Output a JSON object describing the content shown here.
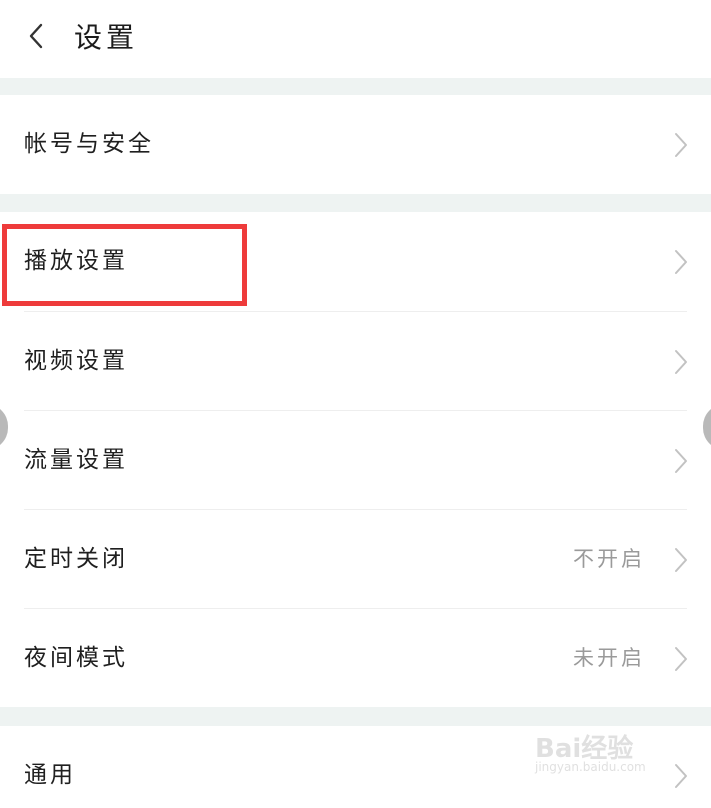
{
  "header": {
    "title": "设置",
    "back_icon": "chevron-left-icon"
  },
  "sections": [
    {
      "items": [
        {
          "label": "帐号与安全",
          "value": ""
        }
      ]
    },
    {
      "items": [
        {
          "label": "播放设置",
          "value": ""
        },
        {
          "label": "视频设置",
          "value": ""
        },
        {
          "label": "流量设置",
          "value": ""
        },
        {
          "label": "定时关闭",
          "value": "不开启"
        },
        {
          "label": "夜间模式",
          "value": "未开启"
        }
      ]
    },
    {
      "items": [
        {
          "label": "通用",
          "value": ""
        }
      ]
    }
  ],
  "watermark": {
    "brand": "Bai经验",
    "url": "jingyan.baidu.com"
  },
  "colors": {
    "background": "#ffffff",
    "section_gap": "#eef3f2",
    "text_primary": "#1f1f1f",
    "text_secondary": "#9a9a9a",
    "chevron": "#c2c2c2",
    "highlight": "#ee3b3b"
  }
}
